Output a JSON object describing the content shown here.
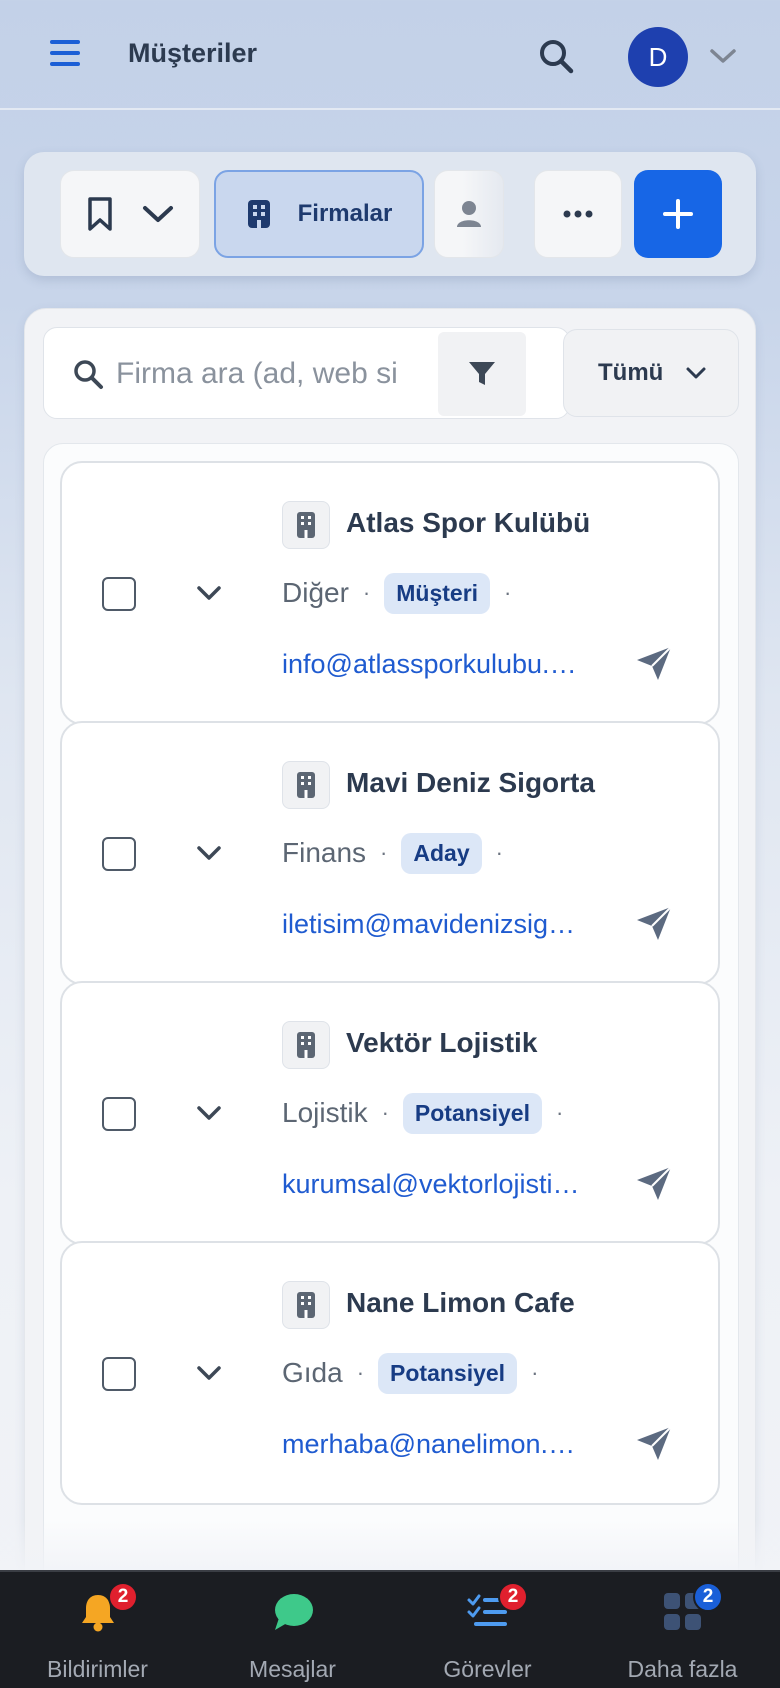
{
  "header": {
    "title": "Müşteriler",
    "avatar_initial": "D"
  },
  "toolbar": {
    "active_tab_label": "Firmalar"
  },
  "search": {
    "placeholder": "Firma ara (ad, web si",
    "scope_label": "Tümü"
  },
  "companies": [
    {
      "name": "Atlas Spor Kulübü",
      "sector": "Diğer",
      "status": "Müşteri",
      "email": "info@atlassporkulubu.e…"
    },
    {
      "name": "Mavi Deniz Sigorta",
      "sector": "Finans",
      "status": "Aday",
      "email": "iletisim@mavidenizsigo…"
    },
    {
      "name": "Vektör Lojistik",
      "sector": "Lojistik",
      "status": "Potansiyel",
      "email": "kurumsal@vektorlojisti…"
    },
    {
      "name": "Nane Limon Cafe",
      "sector": "Gıda",
      "status": "Potansiyel",
      "email": "merhaba@nanelimon.e…"
    }
  ],
  "bottom_nav": [
    {
      "label": "Bildirimler",
      "badge": "2",
      "icon": "bell-icon"
    },
    {
      "label": "Mesajlar",
      "badge": "",
      "icon": "chat-bubble-icon"
    },
    {
      "label": "Görevler",
      "badge": "2",
      "icon": "task-list-icon"
    },
    {
      "label": "Daha fazla",
      "badge": "2",
      "icon": "grid-icon"
    }
  ],
  "colors": {
    "accent": "#1766e6",
    "badge_red": "#e0202e",
    "badge_blue": "#1a5fd8",
    "link": "#1f5bd0"
  }
}
